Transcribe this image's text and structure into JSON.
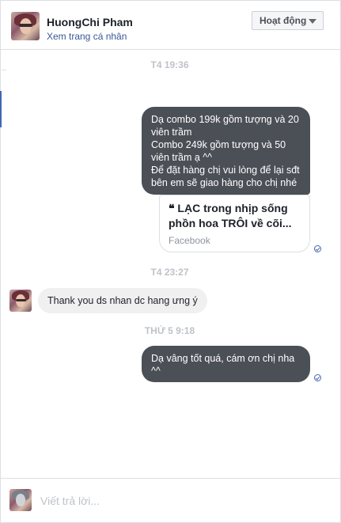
{
  "header": {
    "name": "HuongChi Pham",
    "profile_link": "Xem trang cá nhân",
    "status_button": "Hoạt động"
  },
  "timestamps": {
    "t1": "T4 19:36",
    "t2": "T4 23:27",
    "t3": "THỨ 5 9:18"
  },
  "messages": {
    "outgoing_1": [
      "Dạ combo 199k gồm tượng và 20",
      "viên trầm",
      "Combo 249k gồm tượng và 50",
      "viên trầm ạ ^^",
      "Để đặt hàng chị vui lòng để lại sđt",
      "bên em sẽ giao hàng cho chị nhé"
    ],
    "link_card": {
      "title_line_1": "❝ LẠC trong nhịp sống",
      "title_line_2": "phồn hoa TRÔI về cõi...",
      "source": "Facebook"
    },
    "incoming_1": "Thank you ds nhan dc hang ưng ý",
    "outgoing_2": [
      "Dạ vâng tốt quá, cám ơn chị nha",
      "^^"
    ]
  },
  "composer": {
    "placeholder": "Viết trả lời..."
  },
  "colors": {
    "outgoing_bubble": "#4b4f56",
    "incoming_bubble": "#f1f0f0",
    "link": "#385898",
    "seen": "#4267b2"
  },
  "icons": {
    "status_caret": "caret-down-icon",
    "seen": "seen-check-icon"
  }
}
